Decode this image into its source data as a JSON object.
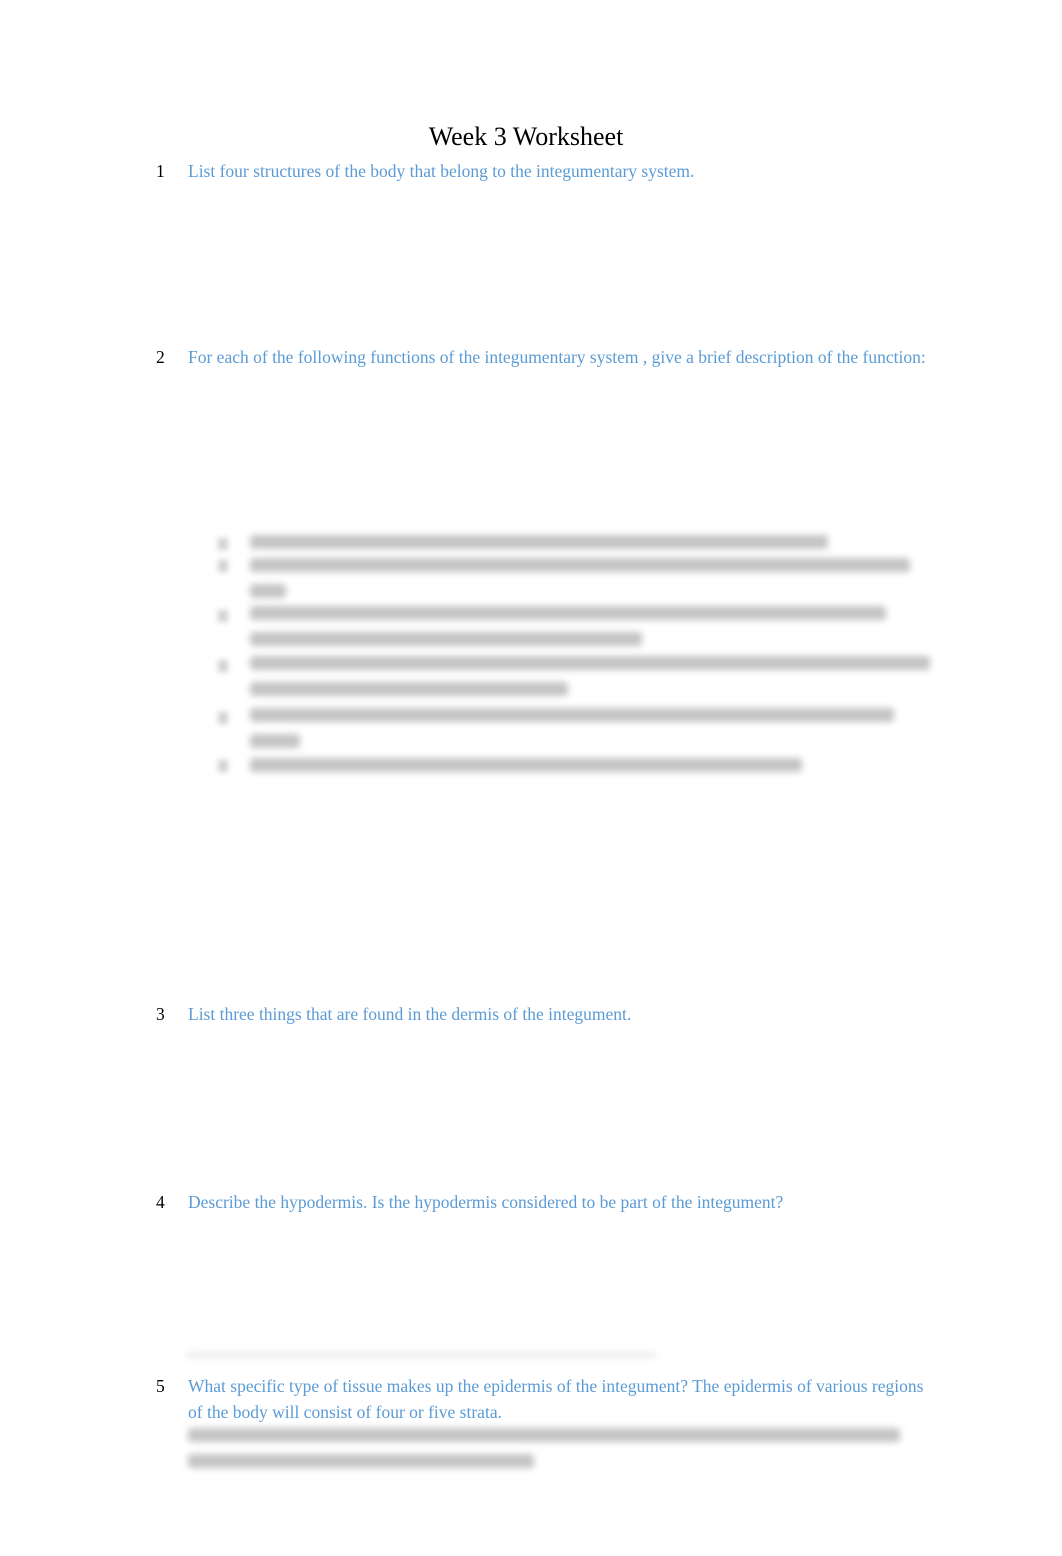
{
  "document": {
    "title": "Week 3 Worksheet",
    "questions": [
      {
        "number": "1",
        "text": "List four structures  of the body that belong to the integumentary system."
      },
      {
        "number": "2",
        "text": "For each of the following functions of the integumentary system   , give a brief description of the function:"
      },
      {
        "number": "3",
        "text": "List three things that are found in the dermis of the integument."
      },
      {
        "number": "4",
        "text": "Describe the hypodermis.  Is the hypodermis considered to be part of the integument?"
      },
      {
        "number": "5",
        "text": "What specific type of tissue makes up the epidermis of the integument?    The epidermis of various regions of the body will consist of four or five strata."
      }
    ],
    "redacted_answer_list_items": 6,
    "redacted_answer_paragraphs": 1
  },
  "colors": {
    "question_text": "#5b9bd5",
    "title_text": "#000000"
  }
}
